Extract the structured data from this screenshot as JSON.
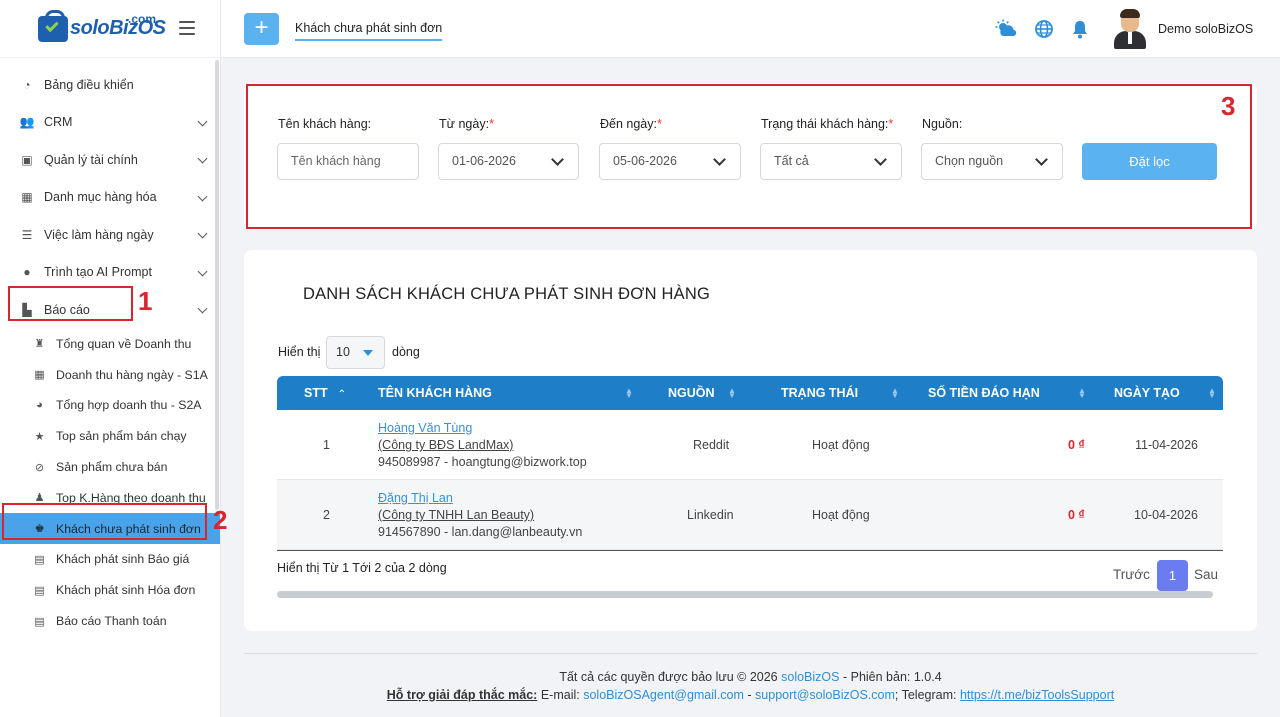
{
  "brand": {
    "name": "soloBizOS",
    "suffix": ".com"
  },
  "sidebar": {
    "items": [
      {
        "label": "Bảng điều khiển",
        "icon": "dashboard-icon",
        "glyph": "◔"
      },
      {
        "label": "CRM",
        "icon": "users-icon",
        "glyph": "👥"
      },
      {
        "label": "Quản lý tài chính",
        "icon": "finance-icon",
        "glyph": "▣"
      },
      {
        "label": "Danh mục hàng hóa",
        "icon": "calendar-icon",
        "glyph": "▦"
      },
      {
        "label": "Việc làm hàng ngày",
        "icon": "tasks-icon",
        "glyph": "☰"
      },
      {
        "label": "Trình tạo AI Prompt",
        "icon": "ai-icon",
        "glyph": "●"
      },
      {
        "label": "Báo cáo",
        "icon": "chart-icon",
        "glyph": "▙"
      }
    ],
    "report_subitems": [
      {
        "label": "Tổng quan về Doanh thu",
        "icon": "money-bag-icon",
        "glyph": "♜"
      },
      {
        "label": "Doanh thu hàng ngày - S1A",
        "icon": "calendar-check-icon",
        "glyph": "▦"
      },
      {
        "label": "Tổng hợp doanh thu - S2A",
        "icon": "pie-icon",
        "glyph": "◕"
      },
      {
        "label": "Top sản phẩm bán chạy",
        "icon": "star-icon",
        "glyph": "★"
      },
      {
        "label": "Sản phẩm chưa bán",
        "icon": "ban-icon",
        "glyph": "⊘"
      },
      {
        "label": "Top K.Hàng theo doanh thu",
        "icon": "people-icon",
        "glyph": "♟"
      },
      {
        "label": "Khách chưa phát sinh đơn",
        "icon": "user-dollar-icon",
        "glyph": "♚"
      },
      {
        "label": "Khách phát sinh Báo giá",
        "icon": "file-quote-icon",
        "glyph": "▤"
      },
      {
        "label": "Khách phát sinh Hóa đơn",
        "icon": "invoice-icon",
        "glyph": "▤"
      },
      {
        "label": "Báo cáo Thanh toán",
        "icon": "payment-icon",
        "glyph": "▤"
      }
    ]
  },
  "topbar": {
    "plus": "+",
    "tab_title": "Khách chưa phát sinh đơn",
    "user_name": "Demo soloBizOS"
  },
  "annotations": {
    "n1": "1",
    "n2": "2",
    "n3": "3"
  },
  "filters": {
    "customer_label": "Tên khách hàng:",
    "customer_placeholder": "Tên khách hàng",
    "from_label": "Từ ngày:",
    "from_value": "01-06-2026",
    "to_label": "Đến ngày:",
    "to_value": "05-06-2026",
    "status_label": "Trạng thái khách hàng:",
    "status_value": "Tất cả",
    "source_label": "Nguồn:",
    "source_value": "Chọn nguồn",
    "required_mark": "*",
    "button": "Đặt lọc"
  },
  "table": {
    "title": "DANH SÁCH KHÁCH CHƯA PHÁT SINH ĐƠN HÀNG",
    "show_prefix": "Hiển thị",
    "page_size": "10",
    "show_suffix": "dòng",
    "columns": [
      "STT",
      "TÊN KHÁCH HÀNG",
      "NGUỒN",
      "TRẠNG THÁI",
      "SỐ TIỀN ĐÁO HẠN",
      "NGÀY TẠO"
    ],
    "rows": [
      {
        "stt": "1",
        "name": "Hoàng Văn Tùng",
        "company": "(Công ty BĐS LandMax)",
        "contact": "945089987 - hoangtung@bizwork.top",
        "source": "Reddit",
        "status": "Hoạt động",
        "amount": "0 ₫",
        "created": "11-04-2026"
      },
      {
        "stt": "2",
        "name": "Đặng Thị Lan",
        "company": "(Công ty TNHH Lan Beauty)",
        "contact": "914567890 - lan.dang@lanbeauty.vn",
        "source": "Linkedin",
        "status": "Hoạt động",
        "amount": "0 ₫",
        "created": "10-04-2026"
      }
    ],
    "info": "Hiển thị Từ 1 Tới 2 của 2 dòng",
    "prev": "Trước",
    "current_page": "1",
    "next": "Sau"
  },
  "footer": {
    "copyright_prefix": "Tất cả các quyền được bảo lưu © 2026",
    "brand_link": "soloBizOS",
    "version": "- Phiên bản: 1.0.4",
    "support_label": "Hỗ trợ giải đáp thắc mắc:",
    "email_label": "E-mail:",
    "email1": "soloBizOSAgent@gmail.com",
    "sep": "-",
    "email2": "support@soloBizOS.com",
    "telegram_label": "; Telegram:",
    "telegram_link": "https://t.me/bizToolsSupport"
  },
  "colors": {
    "accent": "#5bb2f0",
    "header": "#1e7fc8",
    "annotation": "#d7262e",
    "active": "#4aa3e8"
  }
}
